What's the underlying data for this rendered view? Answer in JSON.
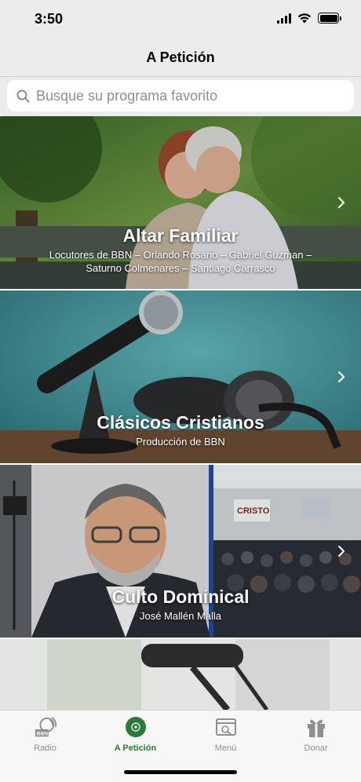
{
  "status_bar": {
    "time": "3:50"
  },
  "nav": {
    "title": "A Petición"
  },
  "search": {
    "placeholder": "Busque su programa favorito",
    "value": ""
  },
  "programs": [
    {
      "title": "Altar Familiar",
      "subtitle_line1": "Locutores de BBN – Orlando Rosario – Gabriel Guzman –",
      "subtitle_line2": "Saturno Colmenares – Santiago Carrasco"
    },
    {
      "title": "Clásicos Cristianos",
      "subtitle_line1": "Producción de BBN"
    },
    {
      "title": "Culto Dominical",
      "subtitle_line1": "José Mallén Malla"
    },
    {
      "title": "",
      "subtitle_line1": ""
    }
  ],
  "image_text": {
    "banner_text": "CRISTO",
    "logo_text": "BBN"
  },
  "tabs": [
    {
      "label": "Radio",
      "icon": "radio-icon"
    },
    {
      "label": "A Petición",
      "icon": "record-icon"
    },
    {
      "label": "Menú",
      "icon": "menu-icon"
    },
    {
      "label": "Donar",
      "icon": "gift-icon"
    }
  ],
  "colors": {
    "accent": "#2b7a3b",
    "inactive": "#8e8e93",
    "bar_bg": "#ececec"
  }
}
